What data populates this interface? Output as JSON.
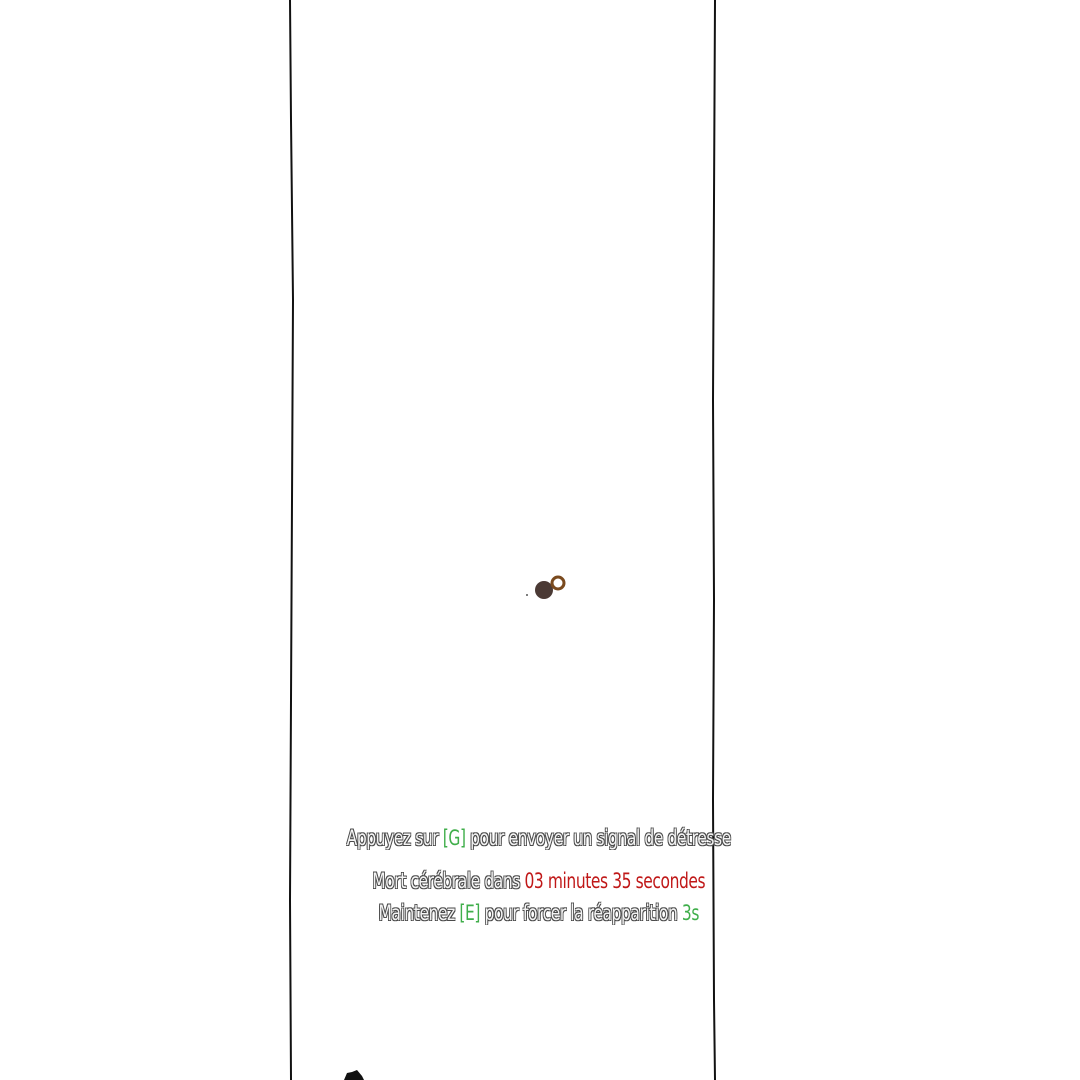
{
  "hud": {
    "distress": {
      "prefix": "Appuyez sur",
      "key": "[G]",
      "suffix": "pour envoyer un signal de détresse"
    },
    "brain_death": {
      "prefix": "Mort cérébrale dans",
      "timer": "03 minutes 35 secondes"
    },
    "respawn": {
      "prefix": "Maintenez",
      "key": "[E]",
      "middle": "pour forcer la réapparition",
      "seconds": "3s"
    }
  },
  "colors": {
    "key_green": "#3fae4a",
    "timer_red": "#c01818",
    "text_white": "#ffffff",
    "text_outline": "#4a4a4a"
  }
}
